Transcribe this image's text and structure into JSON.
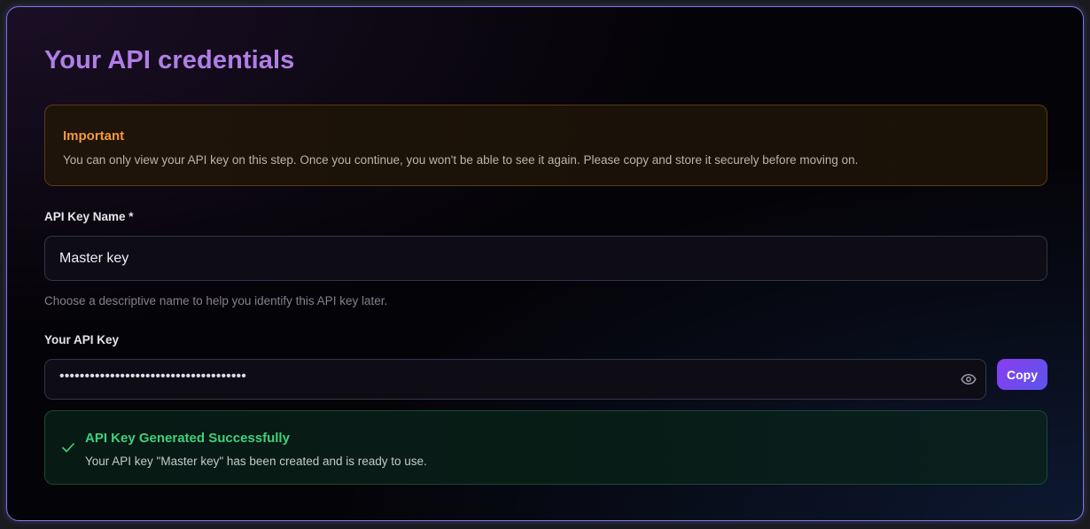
{
  "page": {
    "title": "Your API credentials"
  },
  "warning": {
    "title": "Important",
    "text": "You can only view your API key on this step. Once you continue, you won't be able to see it again. Please copy and store it securely before moving on."
  },
  "key_name": {
    "label": "API Key Name *",
    "value": "Master key",
    "hint": "Choose a descriptive name to help you identify this API key later."
  },
  "api_key": {
    "label": "Your API Key",
    "masked_value": "•••••••••••••••••••••••••••••••••••••",
    "toggle_icon": "eye-icon",
    "copy_label": "Copy"
  },
  "success": {
    "icon": "check-icon",
    "title": "API Key Generated Successfully",
    "text": "Your API key \"Master key\" has been created and is ready to use."
  },
  "colors": {
    "title": "#b07ee6",
    "warning_accent": "#f29a3b",
    "success_accent": "#3ed17d",
    "button_gradient_start": "#8a3cf0",
    "button_gradient_end": "#5a55ea",
    "border_accent": "#7a78e6"
  }
}
